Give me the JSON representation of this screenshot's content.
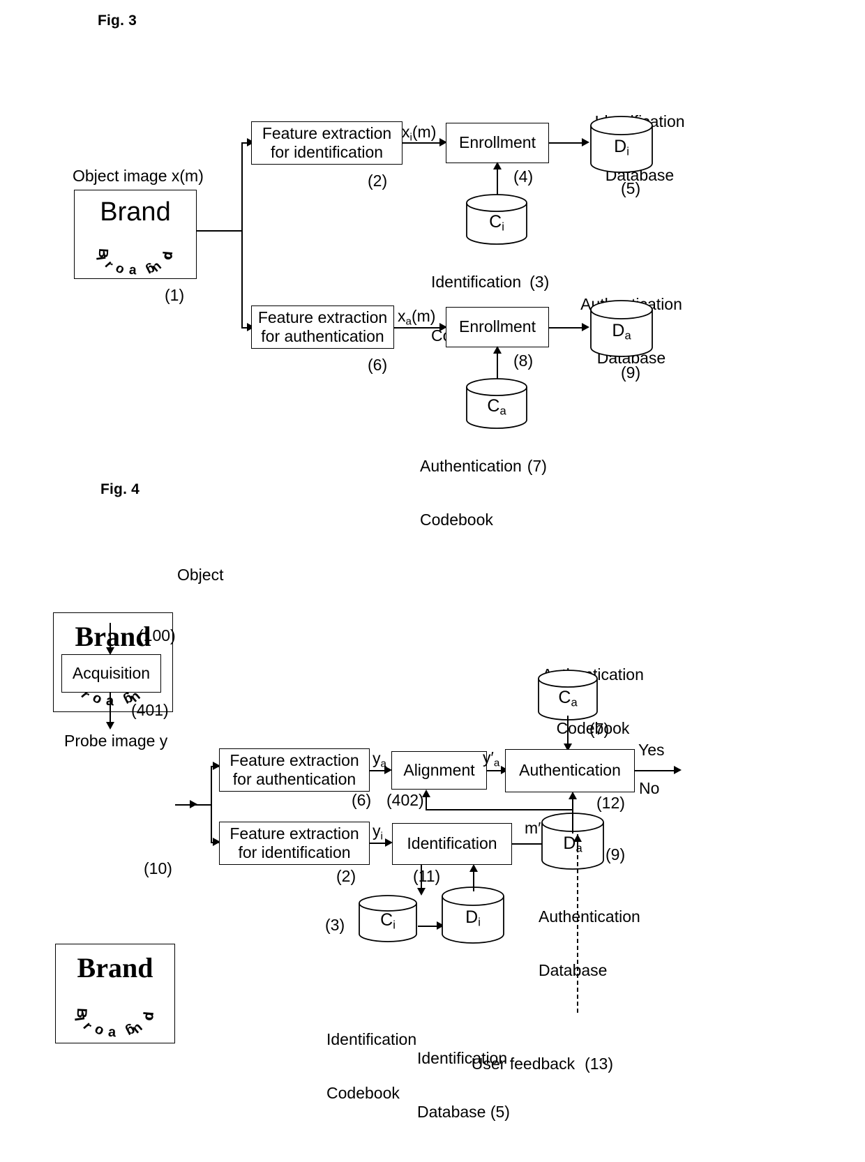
{
  "figures": {
    "fig3": {
      "label": "Fig. 3",
      "object_image": {
        "caption": "Object image x(m)",
        "ref": "(1)",
        "brand_text": "Brand",
        "logo_top": "Brand",
        "logo_bottom": "Logo"
      },
      "boxes": {
        "feature_id": {
          "line1": "Feature extraction",
          "line2": "for identification",
          "ref": "(2)"
        },
        "feature_auth": {
          "line1": "Feature extraction",
          "line2": "for authentication",
          "ref": "(6)"
        },
        "enroll_id": {
          "label": "Enrollment",
          "ref": "(4)"
        },
        "enroll_auth": {
          "label": "Enrollment",
          "ref": "(8)"
        }
      },
      "cylinders": {
        "id_codebook": {
          "symbol": "C",
          "sub": "i",
          "caption_line1": "Identification",
          "caption_line2": "Codebook",
          "ref": "(3)"
        },
        "auth_codebook": {
          "symbol": "C",
          "sub": "a",
          "caption_line1": "Authentication",
          "caption_line2": "Codebook",
          "ref": "(7)"
        },
        "id_database": {
          "symbol": "D",
          "sub": "i",
          "caption_line1": "Identification",
          "caption_line2": "Database",
          "ref": "(5)"
        },
        "auth_database": {
          "symbol": "D",
          "sub": "a",
          "caption_line1": "Authentication",
          "caption_line2": "Database",
          "ref": "(9)"
        }
      },
      "signals": {
        "xi": {
          "base": "x",
          "sub": "i",
          "tail": "(m)"
        },
        "xa": {
          "base": "x",
          "sub": "a",
          "tail": "(m)"
        }
      }
    },
    "fig4": {
      "label": "Fig. 4",
      "object_image": {
        "caption": "Object",
        "ref": "(100)",
        "brand_text": "Brand",
        "logo_top": "Brand",
        "logo_bottom": "Logo"
      },
      "probe_image": {
        "caption": "Probe image y",
        "ref": "(10)",
        "brand_text": "Brand",
        "logo_top": "Brand",
        "logo_bottom": "Logo"
      },
      "boxes": {
        "acquisition": {
          "label": "Acquisition",
          "ref": "(401)"
        },
        "feature_auth": {
          "line1": "Feature extraction",
          "line2": "for authentication",
          "ref": "(6)"
        },
        "feature_id": {
          "line1": "Feature extraction",
          "line2": "for identification",
          "ref": "(2)"
        },
        "alignment": {
          "label": "Alignment",
          "ref": "(402)"
        },
        "authentication": {
          "label": "Authentication",
          "ref": "(12)"
        },
        "identification": {
          "label": "Identification",
          "ref": "(11)"
        }
      },
      "cylinders": {
        "auth_codebook": {
          "symbol": "C",
          "sub": "a",
          "caption_line1": "Authentication",
          "caption_line2": "Codebook",
          "ref": "(7)"
        },
        "id_codebook": {
          "symbol": "C",
          "sub": "i",
          "caption_line1": "Identification",
          "caption_line2": "Codebook",
          "ref": "(3)"
        },
        "id_database": {
          "symbol": "D",
          "sub": "i",
          "caption_line1": "Identification",
          "caption_line2": "Database (5)"
        },
        "auth_database": {
          "symbol": "D",
          "sub": "a",
          "caption_line1": "Authentication",
          "caption_line2": "Database",
          "ref": "(9)"
        }
      },
      "signals": {
        "ya": {
          "base": "y",
          "sub": "a",
          "tail": ""
        },
        "ya_prime": {
          "base": "y′",
          "sub": "a",
          "tail": ""
        },
        "yi": {
          "base": "y",
          "sub": "i",
          "tail": ""
        },
        "m_prime": "m′"
      },
      "outputs": {
        "yes": "Yes",
        "no": "No"
      },
      "feedback": {
        "label": "User feedback",
        "ref": "(13)"
      }
    }
  }
}
